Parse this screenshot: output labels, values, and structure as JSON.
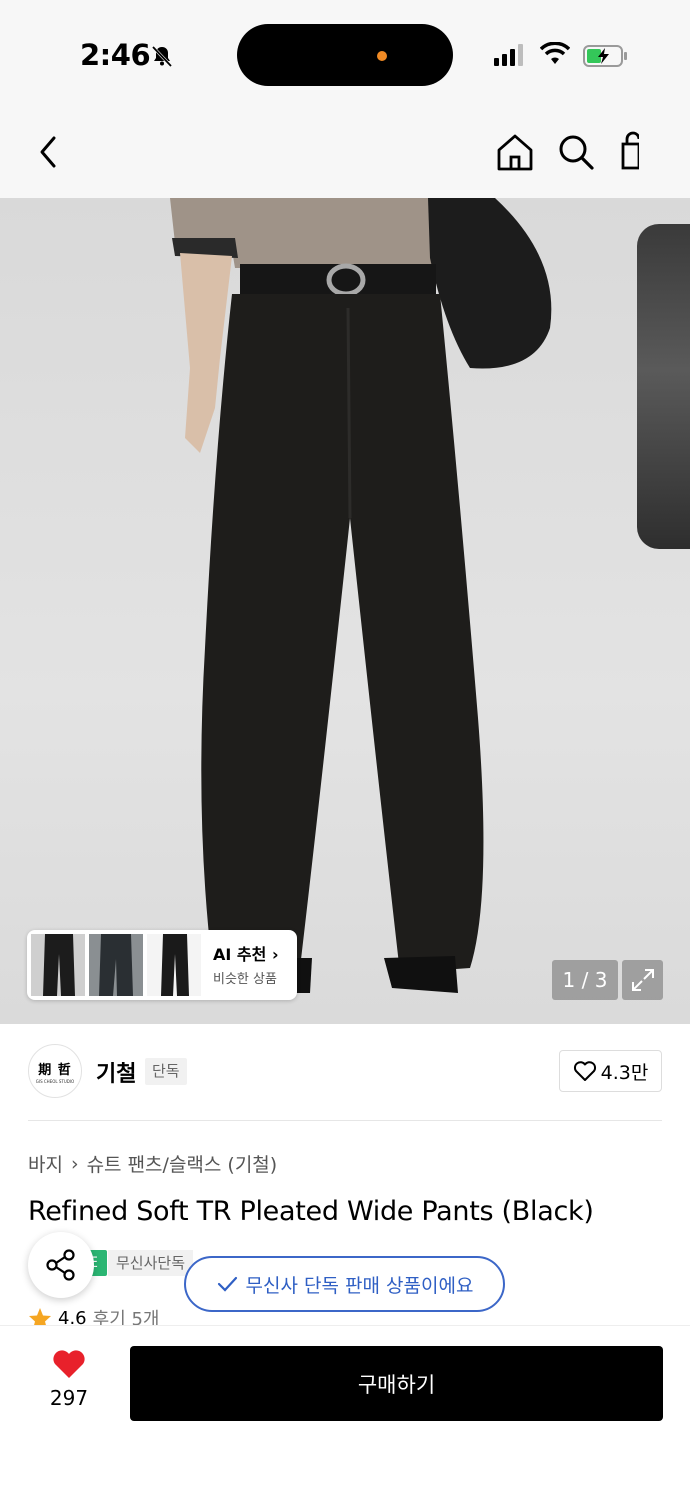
{
  "status_bar": {
    "time": "2:46"
  },
  "gallery": {
    "pager": "1 / 3",
    "ai_title": "AI 추천",
    "ai_subtitle": "비슷한 상품"
  },
  "brand": {
    "logo_text": "期 哲",
    "logo_sub": "GIS CHEOL STUDIO",
    "name": "기철",
    "tag": "단독",
    "likes": "4.3만"
  },
  "breadcrumb": {
    "category": "바지",
    "subcategory": "슈트 팬츠/슬랙스 (기철)"
  },
  "product": {
    "title": "Refined Soft TR Pleated Wide Pants (Black)",
    "badge_gray": "무신사단독",
    "rating": "4.6",
    "reviews": "후기 5개"
  },
  "tooltip": {
    "text": "무신사 단독 판매 상품이에요"
  },
  "bottom": {
    "heart_count": "297",
    "buy_label": "구매하기"
  },
  "colors": {
    "accent_blue": "#2f5fc4",
    "heart_red": "#e8212b",
    "badge_green": "#2bb673",
    "star": "#f5a623"
  }
}
